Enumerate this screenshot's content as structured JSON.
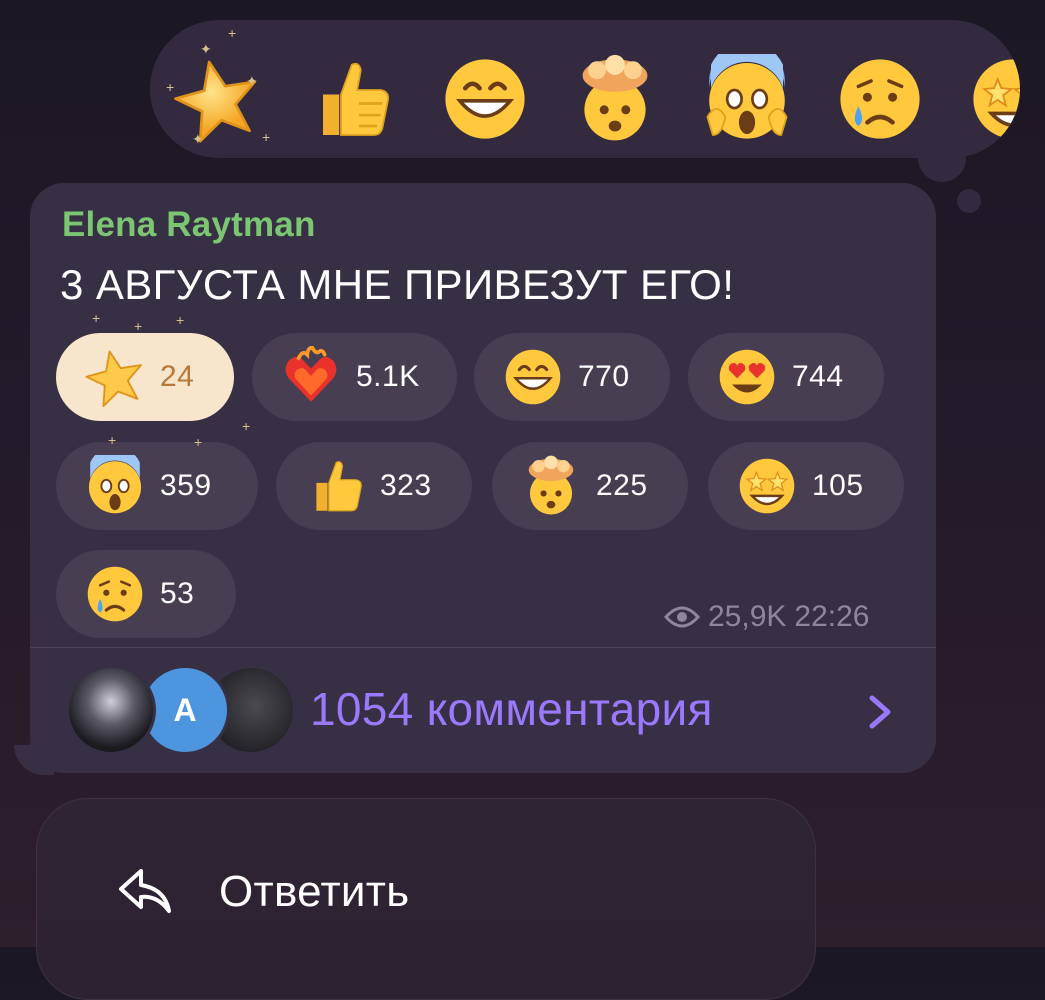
{
  "picker": {
    "items": [
      "star-icon",
      "thumbs-up-icon",
      "grinning-face-icon",
      "exploding-head-icon",
      "screaming-face-icon",
      "crying-face-icon",
      "star-struck-icon"
    ]
  },
  "message": {
    "author": "Elena Raytman",
    "text": "3 АВГУСТА МНЕ ПРИВЕЗУТ ЕГО!",
    "author_color": "#7cc673",
    "reactions": [
      {
        "emoji": "star-icon",
        "count": "24",
        "selected": true
      },
      {
        "emoji": "heart-on-fire-icon",
        "count": "5.1K"
      },
      {
        "emoji": "grinning-face-icon",
        "count": "770"
      },
      {
        "emoji": "heart-eyes-icon",
        "count": "744"
      },
      {
        "emoji": "screaming-face-icon",
        "count": "359"
      },
      {
        "emoji": "thumbs-up-icon",
        "count": "323"
      },
      {
        "emoji": "exploding-head-icon",
        "count": "225"
      },
      {
        "emoji": "star-struck-icon",
        "count": "105"
      },
      {
        "emoji": "crying-face-icon",
        "count": "53"
      }
    ],
    "views": "25,9K",
    "time": "22:26",
    "comments": {
      "label": "1054 комментария",
      "avatar_initial": "A",
      "accent_color": "#9a79ff"
    }
  },
  "menu": {
    "reply_label": "Ответить"
  }
}
